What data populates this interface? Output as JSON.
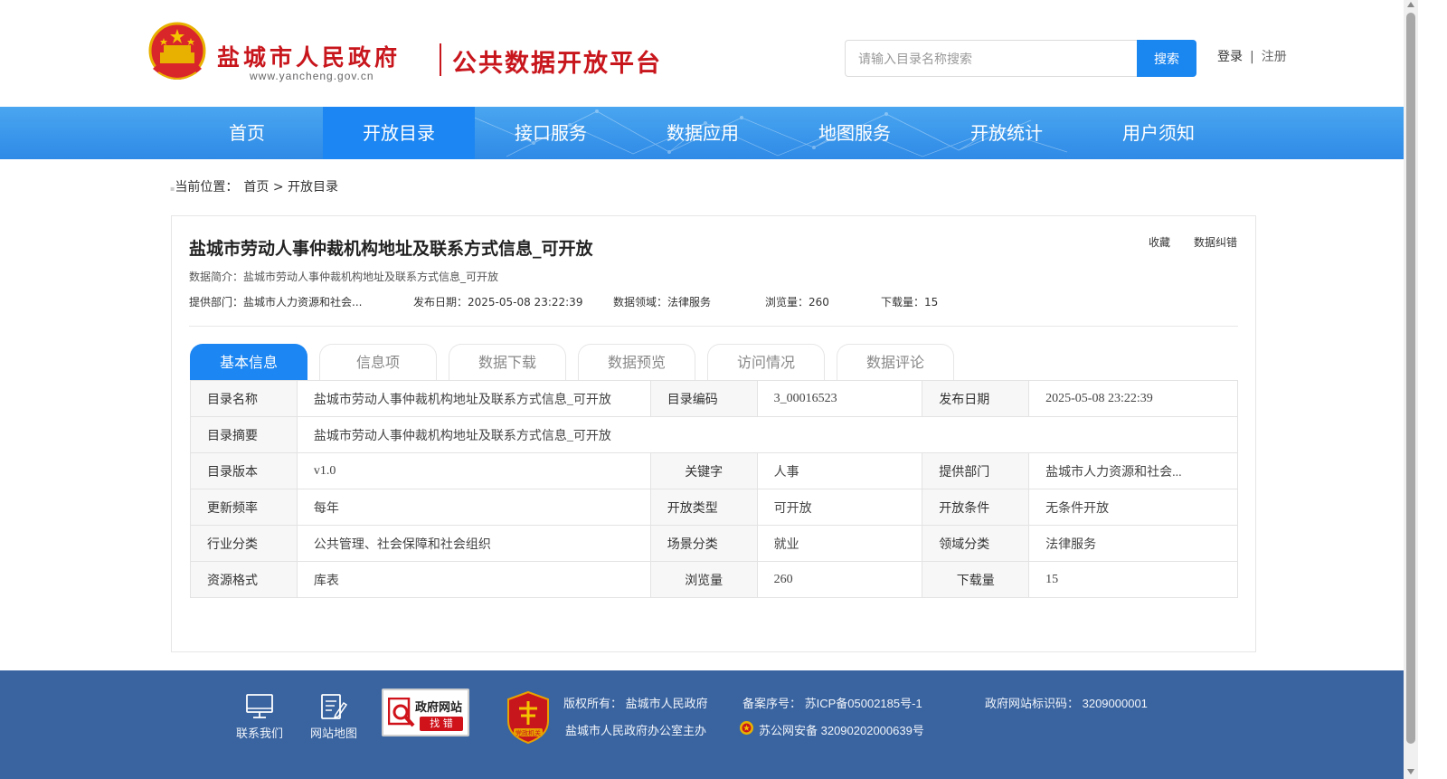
{
  "header": {
    "logo_cn": "盐城市人民政府",
    "logo_url": "www.yancheng.gov.cn",
    "platform_name": "公共数据开放平台",
    "search_placeholder": "请输入目录名称搜索",
    "search_button": "搜索",
    "login": "登录",
    "separator": "|",
    "register": "注册"
  },
  "nav": {
    "items": [
      {
        "label": "首页"
      },
      {
        "label": "开放目录"
      },
      {
        "label": "接口服务"
      },
      {
        "label": "数据应用"
      },
      {
        "label": "地图服务"
      },
      {
        "label": "开放统计"
      },
      {
        "label": "用户须知"
      }
    ],
    "active_index": 1
  },
  "breadcrumb": {
    "prefix": "当前位置：",
    "home": "首页",
    "current": "> 开放目录"
  },
  "dataset": {
    "title": "盐城市劳动人事仲裁机构地址及联系方式信息_可开放",
    "favorite": "收藏",
    "correction": "数据纠错",
    "description": "数据简介：盐城市劳动人事仲裁机构地址及联系方式信息_可开放",
    "provider": "提供部门：盐城市人力资源和社会...",
    "publish_date": "发布日期：2025-05-08 23:22:39",
    "domain": "数据领域：法律服务",
    "views": "浏览量：260",
    "downloads": "下载量：15"
  },
  "tabs": [
    {
      "label": "基本信息"
    },
    {
      "label": "信息项"
    },
    {
      "label": "数据下载"
    },
    {
      "label": "数据预览"
    },
    {
      "label": "访问情况"
    },
    {
      "label": "数据评论"
    }
  ],
  "info": {
    "r1": {
      "l1": "目录名称",
      "v1": "盐城市劳动人事仲裁机构地址及联系方式信息_可开放",
      "l2": "目录编码",
      "v2": "3_00016523",
      "l3": "发布日期",
      "v3": "2025-05-08 23:22:39"
    },
    "r2": {
      "l1": "目录摘要",
      "v1": "盐城市劳动人事仲裁机构地址及联系方式信息_可开放"
    },
    "r3": {
      "l1": "目录版本",
      "v1": "v1.0",
      "l2": "关键字",
      "v2": "人事",
      "l3": "提供部门",
      "v3": "盐城市人力资源和社会..."
    },
    "r4": {
      "l1": "更新频率",
      "v1": "每年",
      "l2": "开放类型",
      "v2": "可开放",
      "l3": "开放条件",
      "v3": "无条件开放"
    },
    "r5": {
      "l1": "行业分类",
      "v1": "公共管理、社会保障和社会组织",
      "l2": "场景分类",
      "v2": "就业",
      "l3": "领域分类",
      "v3": "法律服务"
    },
    "r6": {
      "l1": "资源格式",
      "v1": "库表",
      "l2": "浏览量",
      "v2": "260",
      "l3": "下载量",
      "v3": "15"
    }
  },
  "footer": {
    "contact": "联系我们",
    "sitemap": "网站地图",
    "badge_title": "政府网站",
    "badge_sub": "找 错",
    "seal_text": "党政机关",
    "copyright": "版权所有： 盐城市人民政府",
    "host": "盐城市人民政府办公室主办",
    "icp": "备案序号： 苏ICP备05002185号-1",
    "police": "苏公网安备 32090202000639号",
    "site_id": "政府网站标识码： 3209000001"
  },
  "colors": {
    "brand_red": "#c8161d",
    "primary_blue": "#1c86f2",
    "footer_blue": "#3a64a0"
  }
}
